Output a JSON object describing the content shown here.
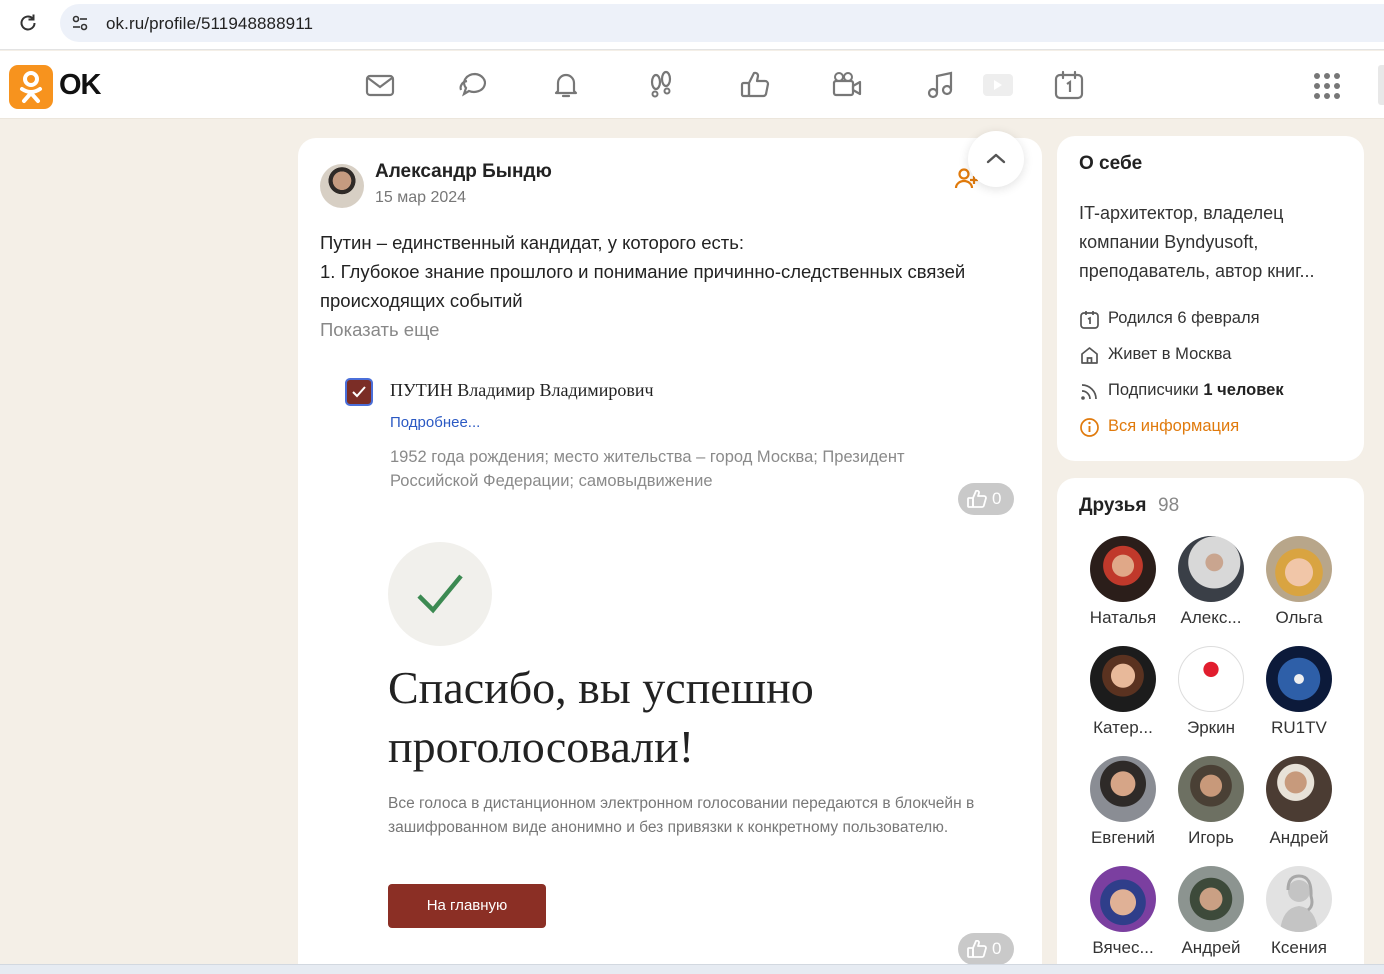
{
  "browser": {
    "url": "ok.ru/profile/511948888911"
  },
  "header": {
    "logo_text": "OK",
    "nav_icons": [
      "mail-icon",
      "chat-icon",
      "bell-icon",
      "guests-icon",
      "like-icon",
      "video-camera-icon",
      "music-icon",
      "video-play-icon",
      "calendar-icon"
    ]
  },
  "post": {
    "author": "Александр Бындю",
    "date": "15 мар 2024",
    "text_lines": [
      "Путин – единственный кандидат, у которого есть:",
      "1. Глубокое знание прошлого и понимание причинно-следственных связей",
      "происходящих событий"
    ],
    "show_more": "Показать еще",
    "poll": {
      "candidate": "ПУТИН Владимир Владимирович",
      "details_link": "Подробнее...",
      "description": "1952 года рождения; место жительства – город Москва; Президент Российской Федерации; самовыдвижение",
      "likes": "0"
    },
    "result": {
      "heading": "Спасибо, вы успешно проголосовали!",
      "note": "Все голоса в дистанционном электронном голосовании передаются в блокчейн в зашифрованном виде анонимно и без привязки к конкретному пользователю.",
      "button": "На главную",
      "likes": "0"
    }
  },
  "about": {
    "title": "О себе",
    "bio_lines": [
      "IT-архитектор, владелец",
      "компании Byndyusoft,",
      "преподаватель, автор книг..."
    ],
    "born": "Родился 6 февраля",
    "lives": "Живет в Москва",
    "subscribers_label": "Подписчики",
    "subscribers_value": "1 человек",
    "all_info": "Вся информация"
  },
  "friends": {
    "title": "Друзья",
    "count": "98",
    "list": [
      {
        "name": "Наталья"
      },
      {
        "name": "Алекс..."
      },
      {
        "name": "Ольга"
      },
      {
        "name": "Катер..."
      },
      {
        "name": "Эркин"
      },
      {
        "name": "RU1TV"
      },
      {
        "name": "Евгений"
      },
      {
        "name": "Игорь"
      },
      {
        "name": "Андрей"
      },
      {
        "name": "Вячес..."
      },
      {
        "name": "Андрей"
      },
      {
        "name": "Ксения"
      }
    ]
  },
  "colors": {
    "brand": "#f7931e",
    "accent_link": "#e07a0c",
    "button": "#8b2f25",
    "check": "#3c8a52"
  }
}
